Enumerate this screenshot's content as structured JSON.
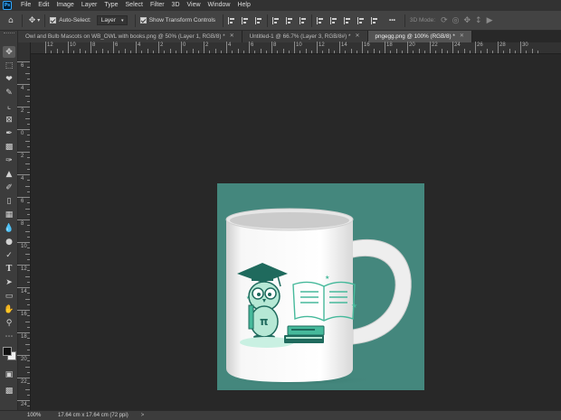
{
  "app": {
    "logo_text": "Ps"
  },
  "menu": [
    "File",
    "Edit",
    "Image",
    "Layer",
    "Type",
    "Select",
    "Filter",
    "3D",
    "View",
    "Window",
    "Help"
  ],
  "options": {
    "auto_select_label": "Auto-Select:",
    "auto_select_checked": true,
    "target_value": "Layer",
    "show_transform_label": "Show Transform Controls",
    "show_transform_checked": true,
    "more_label": "•••",
    "mode_3d_label": "3D Mode:"
  },
  "tabs": [
    {
      "label": "Owl and Bulb Mascots on WB_OWL with books.png @ 50% (Layer 1, RGB/8) *",
      "active": false
    },
    {
      "label": "Untitled-1 @ 66.7% (Layer 3, RGB/8#) *",
      "active": false
    },
    {
      "label": "pngegg.png @ 100% (RGB/8) *",
      "active": true
    }
  ],
  "ruler": {
    "horizontal_labels": [
      "12",
      "10",
      "8",
      "6",
      "4",
      "2",
      "0",
      "2",
      "4",
      "6",
      "8",
      "10",
      "12",
      "14",
      "16",
      "18",
      "20",
      "22",
      "24",
      "26",
      "28",
      "30"
    ],
    "vertical_labels": [
      "6",
      "4",
      "2",
      "0",
      "2",
      "4",
      "6",
      "8",
      "10",
      "12",
      "14",
      "16",
      "18",
      "20",
      "22",
      "24",
      "26"
    ]
  },
  "canvas": {
    "background_color": "#44877d",
    "mug_color": "#f4f4f4",
    "artwork_color": "#46b99b"
  },
  "status": {
    "zoom": "100%",
    "doc_size": "17.64 cm x 17.64 cm (72 ppi)",
    "arrow": ">"
  },
  "tools": [
    "move-tool",
    "artboard-tool",
    "lasso-tool",
    "quick-select-tool",
    "crop-tool",
    "frame-tool",
    "eyedropper-tool",
    "healing-brush-tool",
    "brush-tool",
    "clone-stamp-tool",
    "history-brush-tool",
    "eraser-tool",
    "gradient-tool",
    "blur-tool",
    "dodge-tool",
    "pen-tool",
    "type-tool",
    "path-select-tool",
    "rectangle-tool",
    "hand-tool",
    "zoom-tool",
    "edit-toolbar",
    "color-swatches",
    "quick-mask",
    "screen-mode"
  ]
}
